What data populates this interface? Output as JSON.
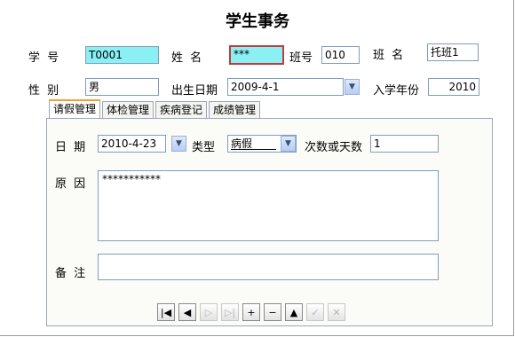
{
  "title": "学生事务",
  "header": {
    "student_id_label": "学  号",
    "student_id_value": "T0001",
    "name_label": "姓  名",
    "name_value": "***",
    "class_no_label": "班号",
    "class_no_value": "010",
    "class_name_label": "班  名",
    "class_name_value": "托班1",
    "gender_label": "性  别",
    "gender_value": "男",
    "birthdate_label": "出生日期",
    "birthdate_value": "2009-4-1",
    "enroll_year_label": "入学年份",
    "enroll_year_value": "2010"
  },
  "tabs": [
    {
      "label": "请假管理",
      "active": true
    },
    {
      "label": "体检管理",
      "active": false
    },
    {
      "label": "疾病登记",
      "active": false
    },
    {
      "label": "成绩管理",
      "active": false
    }
  ],
  "leave": {
    "date_label": "日  期",
    "date_value": "2010-4-23",
    "type_label": "类型",
    "type_value": "病假",
    "count_label": "次数或天数",
    "count_value": "1",
    "reason_label": "原  因",
    "reason_value": "***********",
    "note_label": "备  注",
    "note_value": ""
  },
  "nav": [
    {
      "name": "first-record-icon",
      "glyph": "|◀",
      "enabled": true
    },
    {
      "name": "prev-record-icon",
      "glyph": "◀",
      "enabled": true
    },
    {
      "name": "next-record-icon",
      "glyph": "▷",
      "enabled": false
    },
    {
      "name": "last-record-icon",
      "glyph": "▷|",
      "enabled": false
    },
    {
      "name": "add-record-icon",
      "glyph": "+",
      "enabled": true
    },
    {
      "name": "delete-record-icon",
      "glyph": "−",
      "enabled": true
    },
    {
      "name": "edit-record-icon",
      "glyph": "▲",
      "enabled": true
    },
    {
      "name": "save-record-icon",
      "glyph": "✓",
      "enabled": false
    },
    {
      "name": "cancel-record-icon",
      "glyph": "✕",
      "enabled": false
    }
  ]
}
